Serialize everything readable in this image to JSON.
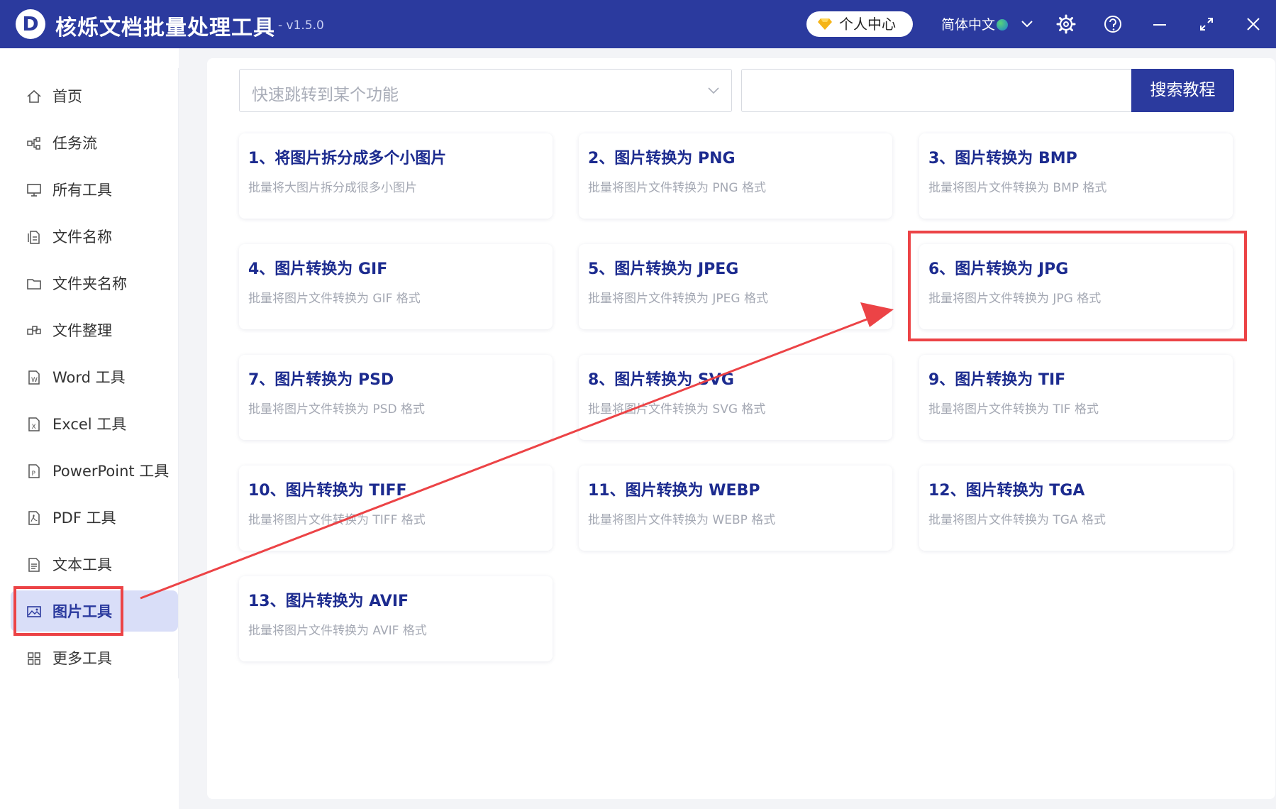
{
  "app": {
    "logo_letter": "D",
    "title": "核烁文档批量处理工具",
    "version": "- v1.5.0",
    "user_center": "个人中心",
    "language": "简体中文"
  },
  "sidebar": {
    "items": [
      {
        "label": "首页",
        "icon": "home-icon"
      },
      {
        "label": "任务流",
        "icon": "workflow-icon"
      },
      {
        "label": "所有工具",
        "icon": "monitor-icon"
      },
      {
        "label": "文件名称",
        "icon": "file-name-icon"
      },
      {
        "label": "文件夹名称",
        "icon": "folder-icon"
      },
      {
        "label": "文件整理",
        "icon": "organize-icon"
      },
      {
        "label": "Word 工具",
        "icon": "word-icon"
      },
      {
        "label": "Excel 工具",
        "icon": "excel-icon"
      },
      {
        "label": "PowerPoint 工具",
        "icon": "powerpoint-icon"
      },
      {
        "label": "PDF 工具",
        "icon": "pdf-icon"
      },
      {
        "label": "文本工具",
        "icon": "text-file-icon"
      },
      {
        "label": "图片工具",
        "icon": "image-icon",
        "active": true
      },
      {
        "label": "更多工具",
        "icon": "grid-icon"
      }
    ]
  },
  "search": {
    "quick_jump_placeholder": "快速跳转到某个功能",
    "search_value": "",
    "search_button": "搜索教程"
  },
  "cards": [
    {
      "title": "1、将图片拆分成多个小图片",
      "desc": "批量将大图片拆分成很多小图片"
    },
    {
      "title": "2、图片转换为 PNG",
      "desc": "批量将图片文件转换为 PNG 格式"
    },
    {
      "title": "3、图片转换为 BMP",
      "desc": "批量将图片文件转换为 BMP 格式"
    },
    {
      "title": "4、图片转换为 GIF",
      "desc": "批量将图片文件转换为 GIF 格式"
    },
    {
      "title": "5、图片转换为 JPEG",
      "desc": "批量将图片文件转换为 JPEG 格式"
    },
    {
      "title": "6、图片转换为 JPG",
      "desc": "批量将图片文件转换为 JPG 格式"
    },
    {
      "title": "7、图片转换为 PSD",
      "desc": "批量将图片文件转换为 PSD 格式"
    },
    {
      "title": "8、图片转换为 SVG",
      "desc": "批量将图片文件转换为 SVG 格式"
    },
    {
      "title": "9、图片转换为 TIF",
      "desc": "批量将图片文件转换为 TIF 格式"
    },
    {
      "title": "10、图片转换为 TIFF",
      "desc": "批量将图片文件转换为 TIFF 格式"
    },
    {
      "title": "11、图片转换为 WEBP",
      "desc": "批量将图片文件转换为 WEBP 格式"
    },
    {
      "title": "12、图片转换为 TGA",
      "desc": "批量将图片文件转换为 TGA 格式"
    },
    {
      "title": "13、图片转换为 AVIF",
      "desc": "批量将图片文件转换为 AVIF 格式"
    }
  ],
  "colors": {
    "brand": "#2b3a9e",
    "card_title": "#1c2b8f",
    "annotation": "#ec4346",
    "active_nav_bg": "#d9def8"
  }
}
